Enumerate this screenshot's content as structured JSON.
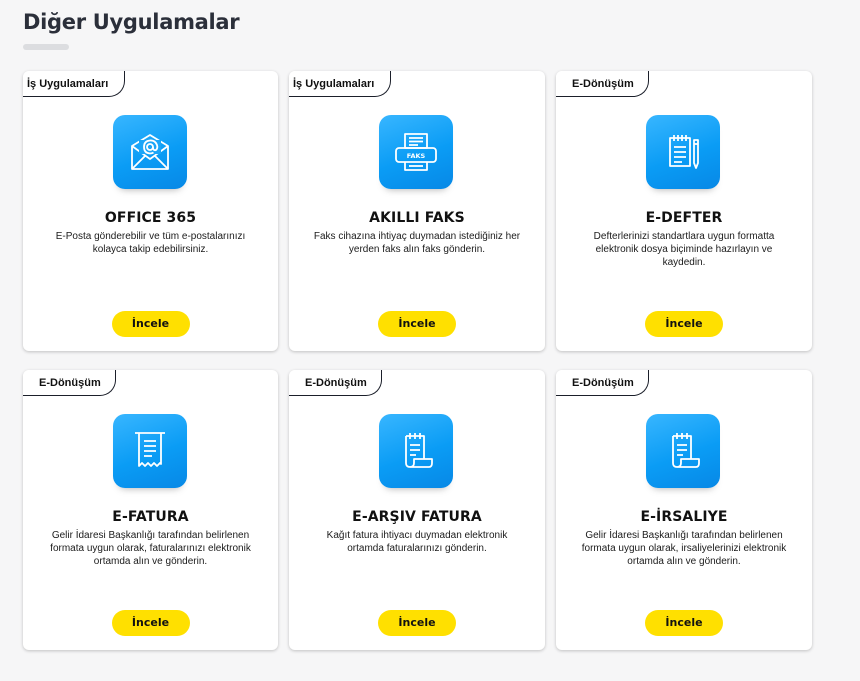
{
  "page": {
    "title": "Diğer Uygulamalar"
  },
  "cards": [
    {
      "tag": "İş Uygulamaları",
      "icon": "email-icon",
      "title": "OFFICE 365",
      "description": "E-Posta gönderebilir ve tüm e-postalarınızı kolayca takip edebilirsiniz.",
      "button": "İncele"
    },
    {
      "tag": "İş Uygulamaları",
      "icon": "fax-icon",
      "icon_text": "FAKS",
      "title": "AKILLI FAKS",
      "description": "Faks cihazına ihtiyaç duymadan istediğiniz her yerden faks alın faks gönderin.",
      "button": "İncele"
    },
    {
      "tag": "E-Dönüşüm",
      "icon": "ledger-pen-icon",
      "title": "E-DEFTER",
      "description": "Defterlerinizi standartlara uygun formatta elektronik dosya biçiminde hazırlayın ve kaydedin.",
      "button": "İncele"
    },
    {
      "tag": "E-Dönüşüm",
      "icon": "invoice-receipt-icon",
      "title": "E-FATURA",
      "description": "Gelir İdaresi Başkanlığı tarafından belirlenen formata uygun olarak, faturalarınızı elektronik ortamda alın ve gönderin.",
      "button": "İncele"
    },
    {
      "tag": "E-Dönüşüm",
      "icon": "archive-document-icon",
      "title": "E-ARŞIV FATURA",
      "description": "Kağıt fatura ihtiyacı duymadan elektronik ortamda faturalarınızı gönderin.",
      "button": "İncele"
    },
    {
      "tag": "E-Dönüşüm",
      "icon": "waybill-document-icon",
      "title": "E-İRSALIYE",
      "description": "Gelir İdaresi Başkanlığı tarafından belirlenen formata uygun olarak, irsaliyelerinizi elektronik ortamda alın ve gönderin.",
      "button": "İncele"
    }
  ],
  "colors": {
    "accent_button": "#ffe000",
    "icon_blue": "#0a9cf5",
    "background": "#f6f6f7"
  }
}
